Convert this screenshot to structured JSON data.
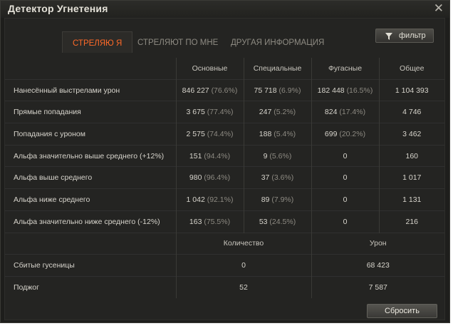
{
  "window": {
    "title": "Детектор Угнетения"
  },
  "tabs": [
    {
      "label": "СТРЕЛЯЮ Я",
      "active": true
    },
    {
      "label": "СТРЕЛЯЮТ ПО МНЕ",
      "active": false
    },
    {
      "label": "ДРУГАЯ ИНФОРМАЦИЯ",
      "active": false
    }
  ],
  "filter_button": {
    "label": "фильтр",
    "icon": "funnel-icon"
  },
  "damage_table": {
    "headers": [
      "Основные",
      "Специальные",
      "Фугасные",
      "Общее"
    ],
    "rows": [
      {
        "label": "Нанесённый выстрелами урон",
        "basic": "846 227",
        "basic_pct": "(76.6%)",
        "special": "75 718",
        "special_pct": "(6.9%)",
        "he": "182 448",
        "he_pct": "(16.5%)",
        "total": "1 104 393"
      },
      {
        "label": "Прямые попадания",
        "basic": "3 675",
        "basic_pct": "(77.4%)",
        "special": "247",
        "special_pct": "(5.2%)",
        "he": "824",
        "he_pct": "(17.4%)",
        "total": "4 746"
      },
      {
        "label": "Попадания с уроном",
        "basic": "2 575",
        "basic_pct": "(74.4%)",
        "special": "188",
        "special_pct": "(5.4%)",
        "he": "699",
        "he_pct": "(20.2%)",
        "total": "3 462"
      },
      {
        "label": "Альфа значительно выше среднего (+12%)",
        "basic": "151",
        "basic_pct": "(94.4%)",
        "special": "9",
        "special_pct": "(5.6%)",
        "he": "0",
        "he_pct": "",
        "total": "160"
      },
      {
        "label": "Альфа выше среднего",
        "basic": "980",
        "basic_pct": "(96.4%)",
        "special": "37",
        "special_pct": "(3.6%)",
        "he": "0",
        "he_pct": "",
        "total": "1 017"
      },
      {
        "label": "Альфа ниже среднего",
        "basic": "1 042",
        "basic_pct": "(92.1%)",
        "special": "89",
        "special_pct": "(7.9%)",
        "he": "0",
        "he_pct": "",
        "total": "1 131"
      },
      {
        "label": "Альфа значительно ниже среднего (-12%)",
        "basic": "163",
        "basic_pct": "(75.5%)",
        "special": "53",
        "special_pct": "(24.5%)",
        "he": "0",
        "he_pct": "",
        "total": "216"
      }
    ]
  },
  "extra_table": {
    "headers": [
      "Количество",
      "Урон"
    ],
    "rows": [
      {
        "label": "Сбитые гусеницы",
        "count": "0",
        "damage": "68 423"
      },
      {
        "label": "Поджог",
        "count": "52",
        "damage": "7 587"
      }
    ]
  },
  "reset_button": {
    "label": "Сбросить"
  }
}
